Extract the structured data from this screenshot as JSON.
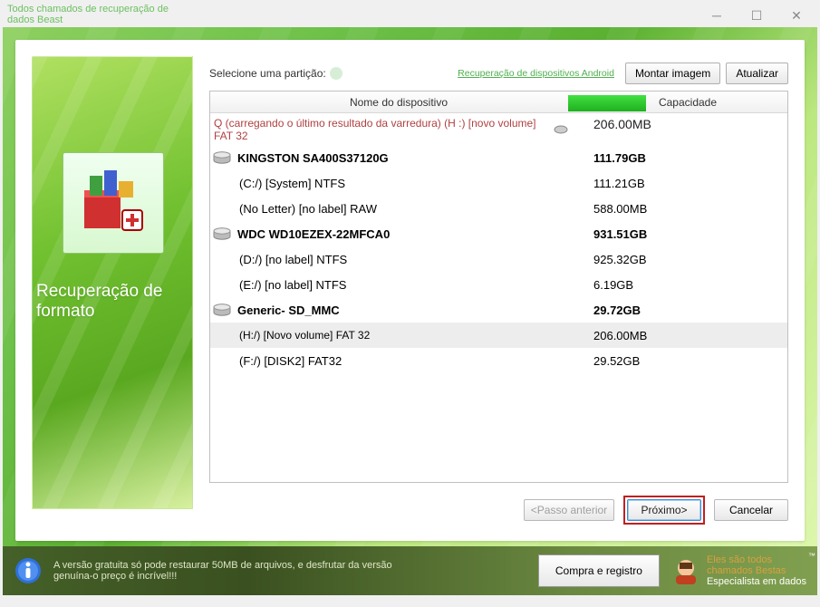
{
  "window": {
    "title": "Todos chamados de recuperação de dados Beast"
  },
  "panel": {
    "select_label": "Selecione uma partição:",
    "android_link": "Recuperação de dispositivos Android",
    "mount_btn": "Montar imagem",
    "refresh_btn": "Atualizar",
    "banner_title": "Recuperação de formato"
  },
  "table": {
    "header_name": "Nome do dispositivo",
    "header_cap": "Capacidade",
    "last_scan": "Q (carregando o último resultado da varredura) (H :) [novo volume] FAT 32",
    "last_scan_cap": "206.00MB",
    "disks": [
      {
        "name": "KINGSTON SA400S37120G",
        "cap": "111.79GB",
        "parts": [
          {
            "name": "(C:/) [System] NTFS",
            "cap": "111.21GB"
          },
          {
            "name": "(No Letter) [no label] RAW",
            "cap": "588.00MB"
          }
        ]
      },
      {
        "name": "WDC WD10EZEX-22MFCA0",
        "cap": "931.51GB",
        "parts": [
          {
            "name": "(D:/) [no label] NTFS",
            "cap": "925.32GB"
          },
          {
            "name": "(E:/) [no label] NTFS",
            "cap": "6.19GB"
          }
        ]
      },
      {
        "name": "Generic- SD_MMC",
        "cap": "29.72GB",
        "parts": [
          {
            "name": "(H:/) [Novo volume] FAT 32",
            "cap": "206.00MB",
            "selected": true
          },
          {
            "name": "(F:/) [DISK2] FAT32",
            "cap": "29.52GB"
          }
        ]
      }
    ]
  },
  "nav": {
    "back": "<Passo anterior",
    "next": "Próximo>",
    "cancel": "Cancelar"
  },
  "footer": {
    "info": "A versão gratuita só pode restaurar 50MB de arquivos, e desfrutar da versão genuína-o preço é incrível!!!",
    "buy": "Compra e registro",
    "brand_l1": "Eles são todos",
    "brand_l2": "chamados Bestas",
    "brand_l3": "Especialista em dados"
  }
}
